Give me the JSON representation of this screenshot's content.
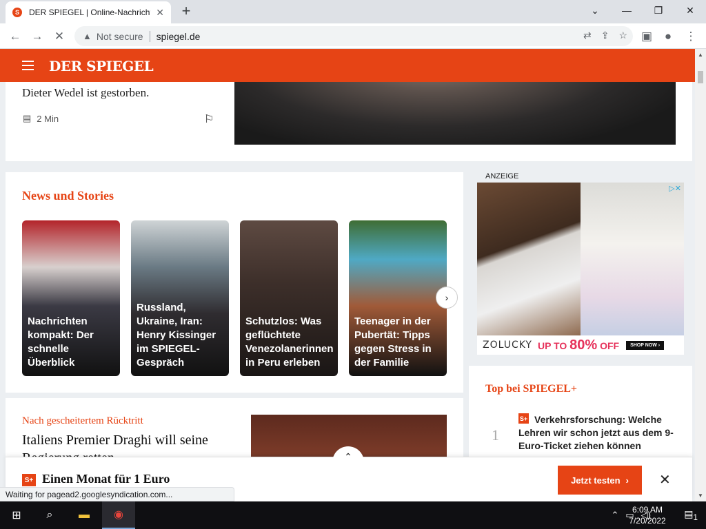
{
  "browser": {
    "tab_title": "DER SPIEGEL | Online-Nachrichten",
    "tab_close": "✕",
    "new_tab": "+",
    "window_controls": {
      "chevron": "⌄",
      "minimize": "—",
      "restore": "❐",
      "close": "✕"
    },
    "back": "←",
    "forward": "→",
    "reload": "✕",
    "security_label": "Not secure",
    "url": "spiegel.de",
    "status_text": "Waiting for pagead2.googlesyndication.com..."
  },
  "header": {
    "logo": "DER SPIEGEL",
    "brand_color": "#e64415"
  },
  "article_top": {
    "teaser": "Dieter Wedel ist gestorben.",
    "read_time": "2 Min"
  },
  "news_stories": {
    "title": "News und Stories",
    "items": [
      {
        "caption": "Nachrichten kompakt: Der schnelle Überblick"
      },
      {
        "caption": "Russland, Ukraine, Iran: Henry Kissinger im SPIEGEL-Gespräch"
      },
      {
        "caption": "Schutzlos: Was geflüchtete Venezolanerinnen in Peru erleben"
      },
      {
        "caption": "Teenager in der Pubertät: Tipps gegen Stress in der Familie"
      }
    ],
    "next_icon": "›"
  },
  "ad": {
    "label": "ANZEIGE",
    "brand": "ZOLUCKY",
    "offer_prefix": "UP TO",
    "offer_value": "80%",
    "offer_suffix": "OFF",
    "shop_button": "SHOP NOW ›"
  },
  "story": {
    "kicker": "Nach gescheitertem Rücktritt",
    "headline": "Italiens Premier Draghi will seine Regierung retten"
  },
  "top_plus": {
    "title": "Top bei SPIEGEL+",
    "items": [
      {
        "rank": "1",
        "text": "Verkehrsforschung: Welche Lehren wir schon jetzt aus dem 9-Euro-Ticket ziehen können"
      }
    ]
  },
  "subscribe_bar": {
    "badge": "S+",
    "offer": "Einen Monat für 1 Euro",
    "cta": "Jetzt testen",
    "cta_arrow": "›",
    "close": "✕"
  },
  "taskbar": {
    "time": "6:09 AM",
    "date": "7/20/2022",
    "notification_count": "1"
  }
}
